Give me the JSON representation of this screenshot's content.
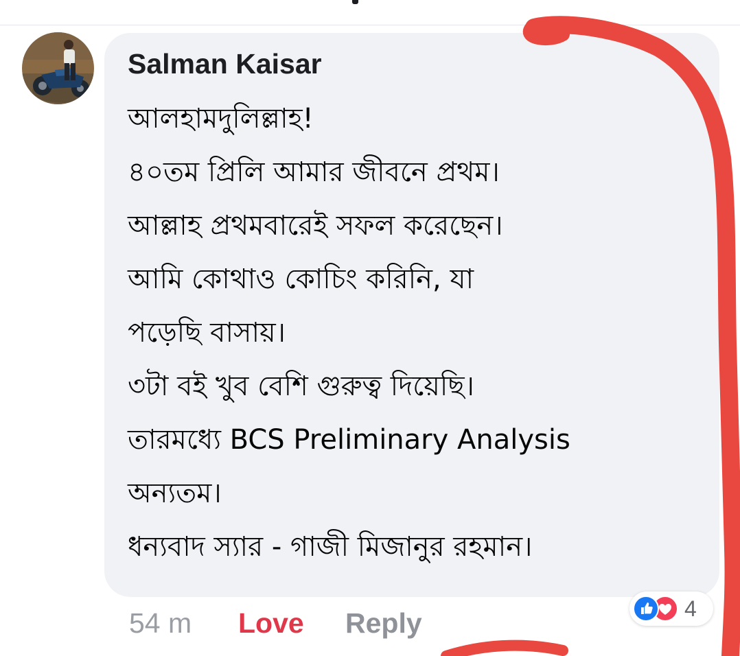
{
  "comment": {
    "author": "Salman Kaisar",
    "lines": [
      "আলহামদুলিল্লাহ!",
      "৪০তম প্রিলি আমার জীবনে প্রথম।",
      "আল্লাহ প্রথমবারেই সফল করেছেন।",
      "আমি কোথাও কোচিং করিনি, যা",
      "পড়েছি বাসায়।",
      "৩টা বই খুব বেশি গুরুত্ব দিয়েছি।",
      "তারমধ্যে BCS Preliminary Analysis",
      "অন্যতম।",
      "ধন্যবাদ স্যার - গাজী মিজানুর রহমান।"
    ]
  },
  "actions": {
    "timestamp": "54 m",
    "love_label": "Love",
    "reply_label": "Reply"
  },
  "reactions": {
    "icons": [
      "like-icon",
      "love-icon"
    ],
    "count": "4"
  },
  "colors": {
    "bubble": "#f0f2f5",
    "love": "#e0384b",
    "like_blue": "#1877f2",
    "love_red": "#f33e58",
    "annotation_red": "#e8483f"
  }
}
